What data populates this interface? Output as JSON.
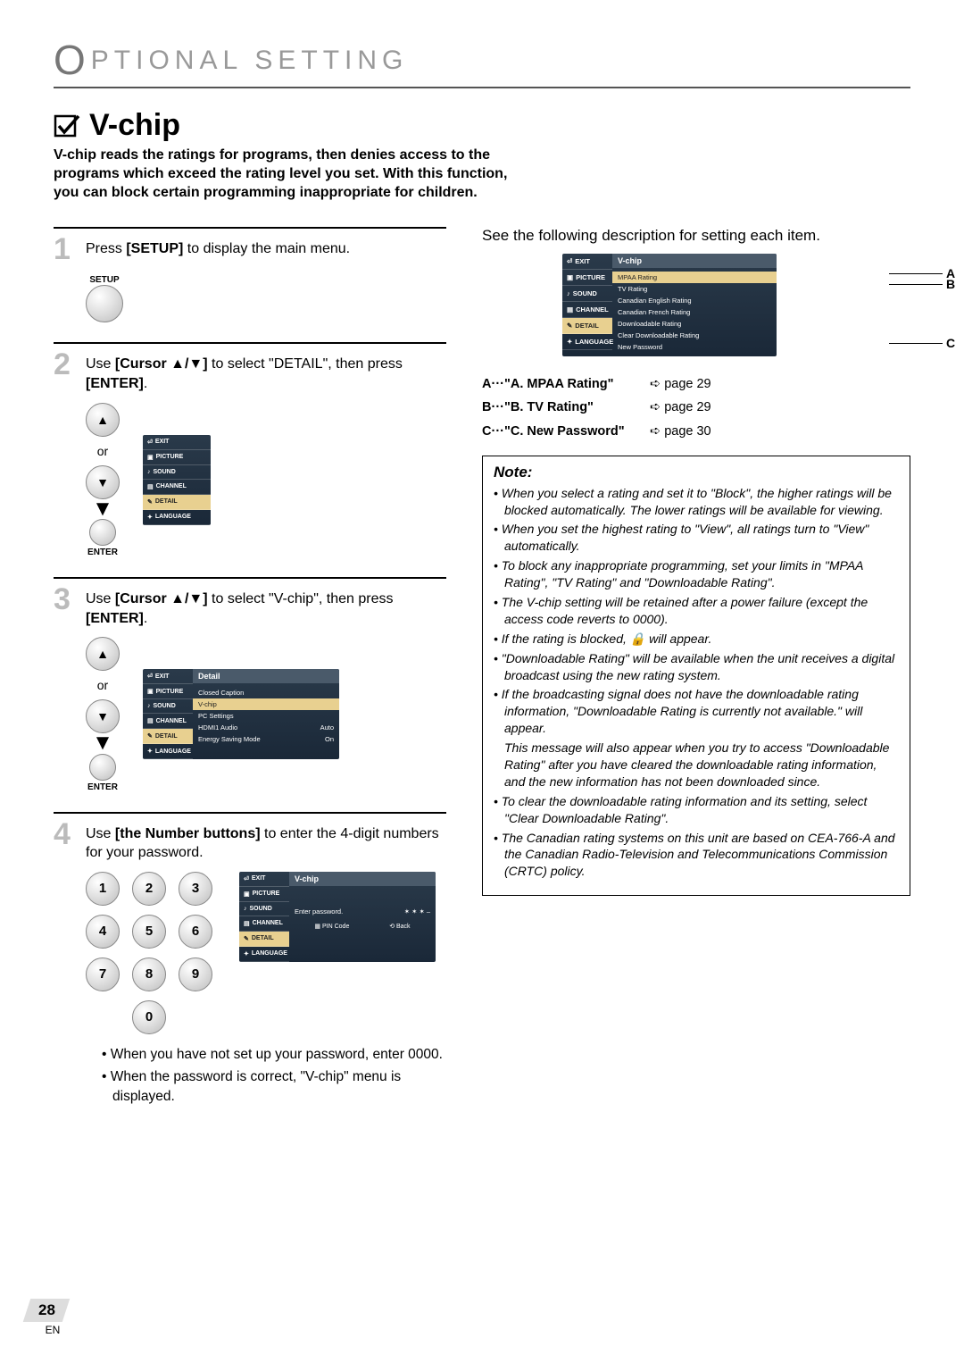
{
  "header": {
    "title": "PTIONAL  SETTING"
  },
  "section": {
    "title": "V-chip",
    "intro": "V-chip reads the ratings for programs, then denies access to the programs which exceed the rating level you set. With this function, you can block certain programming inappropriate for children."
  },
  "steps": {
    "s1": {
      "num": "1",
      "text_a": "Press ",
      "bold_a": "[SETUP]",
      "text_b": " to display the main menu.",
      "btn_label": "SETUP"
    },
    "s2": {
      "num": "2",
      "text_a": "Use ",
      "bold_a": "[Cursor ▲/▼]",
      "text_b": " to select \"DETAIL\", then press ",
      "bold_b": "[ENTER]",
      "tail": ".",
      "or": "or",
      "enter_label": "ENTER"
    },
    "s3": {
      "num": "3",
      "text_a": "Use ",
      "bold_a": "[Cursor ▲/▼]",
      "text_b": " to select \"V-chip\", then press ",
      "bold_b": "[ENTER]",
      "tail": ".",
      "or": "or",
      "enter_label": "ENTER"
    },
    "s4": {
      "num": "4",
      "text_a": "Use ",
      "bold_a": "[the Number buttons]",
      "text_b": " to enter the 4-digit numbers for your password.",
      "numbers": [
        "1",
        "2",
        "3",
        "4",
        "5",
        "6",
        "7",
        "8",
        "9",
        "0"
      ],
      "bullets": [
        "When you have not set up your password, enter 0000.",
        "When the password is correct, \"V-chip\" menu is displayed."
      ]
    }
  },
  "osd": {
    "menu_items": [
      "EXIT",
      "PICTURE",
      "SOUND",
      "CHANNEL",
      "DETAIL",
      "LANGUAGE"
    ],
    "detail": {
      "title": "Detail",
      "rows": [
        {
          "l": "Closed Caption",
          "r": ""
        },
        {
          "l": "V-chip",
          "r": ""
        },
        {
          "l": "PC Settings",
          "r": ""
        },
        {
          "l": "HDMI1 Audio",
          "r": "Auto"
        },
        {
          "l": "Energy Saving Mode",
          "r": "On"
        }
      ]
    },
    "vchip_pwd": {
      "title": "V-chip",
      "prompt": "Enter password.",
      "stars": "✶   ✶   ✶   –",
      "foot_pin": "PIN Code",
      "foot_back": "Back"
    },
    "vchip_menu": {
      "title": "V-chip",
      "rows": [
        "MPAA Rating",
        "TV Rating",
        "Canadian English Rating",
        "Canadian French Rating",
        "Downloadable Rating",
        "Clear Downloadable Rating",
        "New Password"
      ]
    }
  },
  "right": {
    "see_desc": "See the following description for setting each item.",
    "callouts": {
      "a": "A",
      "b": "B",
      "c": "C"
    },
    "refs": [
      {
        "key": "A",
        "label": "\"A. MPAA Rating\"",
        "page": "page 29"
      },
      {
        "key": "B",
        "label": "\"B. TV Rating\"",
        "page": "page 29"
      },
      {
        "key": "C",
        "label": "\"C. New Password\"",
        "page": "page 30"
      }
    ],
    "note_title": "Note:",
    "notes": [
      "When you select a rating and set it to \"Block\", the higher ratings will be blocked automatically. The lower ratings will be available for viewing.",
      "When you set the highest rating to \"View\", all ratings turn to \"View\" automatically.",
      "To block any inappropriate programming, set your limits in \"MPAA Rating\", \"TV Rating\" and \"Downloadable Rating\".",
      "The V-chip setting will be retained after a power failure (except the access code reverts to 0000).",
      "If the rating is blocked, 🔒 will appear.",
      "\"Downloadable Rating\" will be available when the unit receives a digital broadcast using the new rating system.",
      "If the broadcasting signal does not have the downloadable rating information, \"Downloadable Rating is currently not available.\" will appear.",
      "This message will also appear when you try to access \"Downloadable Rating\" after you have cleared the downloadable rating information, and the new information has not been downloaded since.",
      "To clear the downloadable rating information and its setting, select \"Clear Downloadable Rating\".",
      "The Canadian rating systems on this unit are based on CEA-766-A and the Canadian Radio-Television and Telecommunications Commission (CRTC) policy."
    ]
  },
  "footer": {
    "page_num": "28",
    "lang": "EN"
  }
}
